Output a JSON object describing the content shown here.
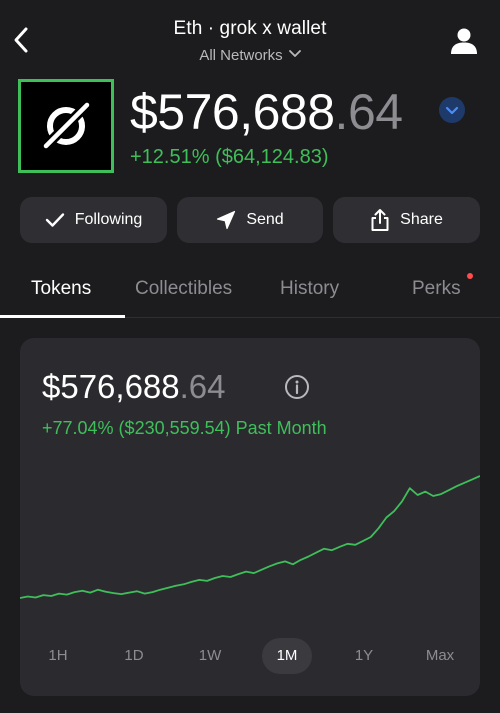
{
  "header": {
    "title": "Eth · grok x wallet",
    "network": "All Networks"
  },
  "wallet": {
    "balance_int": "$576,688",
    "balance_dec": ".64",
    "change": "+12.51% ($64,124.83)"
  },
  "actions": [
    {
      "label": "Following",
      "icon": "check-icon"
    },
    {
      "label": "Send",
      "icon": "send-icon"
    },
    {
      "label": "Share",
      "icon": "share-icon"
    }
  ],
  "tabs": [
    {
      "label": "Tokens",
      "active": true
    },
    {
      "label": "Collectibles",
      "active": false
    },
    {
      "label": "History",
      "active": false
    },
    {
      "label": "Perks",
      "active": false,
      "notification_dot": true
    }
  ],
  "card": {
    "balance_int": "$576,688",
    "balance_dec": ".64",
    "change": "+77.04% ($230,559.54) Past Month"
  },
  "ranges": [
    {
      "label": "1H",
      "active": false
    },
    {
      "label": "1D",
      "active": false
    },
    {
      "label": "1W",
      "active": false
    },
    {
      "label": "1M",
      "active": true
    },
    {
      "label": "1Y",
      "active": false
    },
    {
      "label": "Max",
      "active": false
    }
  ],
  "colors": {
    "background": "#1c1c1e",
    "card": "#2b2b2f",
    "button": "#2f2f33",
    "accent_green": "#3fbf5a",
    "muted_text": "#8c8c91",
    "network_badge": "#1e3a6b",
    "notification": "#ff4d4d"
  },
  "chart_data": {
    "type": "line",
    "xlabel": "",
    "ylabel": "",
    "x": [
      0,
      1,
      2,
      3,
      4,
      5,
      6,
      7,
      8,
      9,
      10,
      11,
      12,
      13,
      14,
      15,
      16,
      17,
      18,
      19,
      20,
      21,
      22,
      23,
      24,
      25,
      26,
      27,
      28,
      29,
      30,
      31,
      32,
      33,
      34,
      35,
      36,
      37,
      38,
      39,
      40,
      41,
      42,
      43,
      44,
      45,
      46,
      47,
      48,
      49,
      50,
      51,
      52,
      53,
      54,
      55,
      56,
      57,
      58,
      59
    ],
    "y": [
      327000,
      330000,
      328000,
      333000,
      331000,
      336000,
      334000,
      339000,
      342000,
      338000,
      344000,
      340000,
      337000,
      335000,
      338000,
      341000,
      336000,
      339000,
      344000,
      348000,
      352000,
      355000,
      360000,
      364000,
      362000,
      368000,
      372000,
      370000,
      376000,
      381000,
      378000,
      385000,
      392000,
      398000,
      402000,
      396000,
      405000,
      412000,
      420000,
      428000,
      425000,
      432000,
      438000,
      436000,
      444000,
      452000,
      470000,
      492000,
      505000,
      525000,
      552000,
      538000,
      545000,
      536000,
      540000,
      548000,
      556000,
      563000,
      570000,
      577000
    ],
    "series": [
      {
        "values_ref": "y",
        "color": "#3fbf5a"
      }
    ]
  }
}
